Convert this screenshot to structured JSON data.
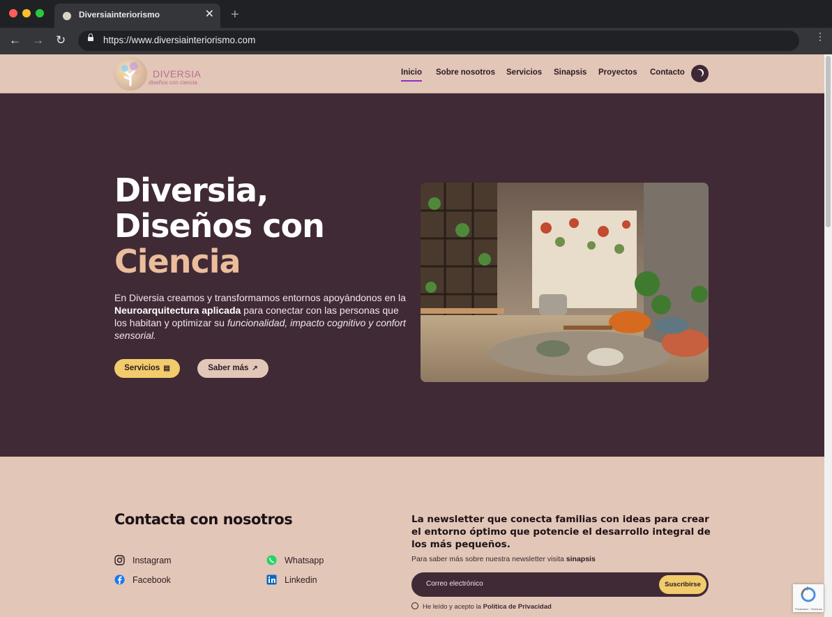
{
  "browser": {
    "tab_title": "Diversiainteriorismo",
    "url": "https://www.diversiainteriorismo.com",
    "tab_close": "✕",
    "new_tab": "+",
    "back": "←",
    "forward": "→",
    "reload": "↻",
    "menu": "⋮"
  },
  "header": {
    "logo_word": "DIVERSIA",
    "logo_sub": "diseños con ciencia",
    "nav": [
      "Inicio",
      "Sobre nosotros",
      "Servicios",
      "Sinapsis",
      "Proyectos",
      "Contacto"
    ],
    "active_nav": "Inicio"
  },
  "hero": {
    "title_line1": "Diversia,",
    "title_line2": "Diseños con",
    "title_line3": "Ciencia",
    "text_1": "En Diversia creamos y transformamos entornos apoyándonos en la ",
    "text_bold": "Neuroarquitectura aplicada",
    "text_2": " para conectar con las personas que los habitan y optimizar su ",
    "text_italic": "funcionalidad, impacto cognitivo y confort sensorial",
    "text_3": ".",
    "btn_services": "Servicios",
    "btn_more": "Saber más"
  },
  "contact": {
    "title": "Contacta con nosotros",
    "social": {
      "instagram": "Instagram",
      "whatsapp": "Whatsapp",
      "facebook": "Facebook",
      "linkedin": "Linkedin"
    }
  },
  "newsletter": {
    "title": "La newsletter que conecta familias con ideas para crear el entorno óptimo que potencie el desarrollo integral de los más pequeños.",
    "sub_text": "Para saber más sobre nuestra newsletter visita ",
    "sub_link": "sinapsis",
    "email_placeholder": "Correo electrónico",
    "subscribe": "Suscribirse",
    "privacy_text": "He leído y acepto la ",
    "privacy_link": "Política de Privacidad"
  },
  "recaptcha": {
    "footer": "Privacidad - Términos"
  },
  "colors": {
    "hero_bg": "#402a36",
    "page_bg": "#e2c6b7",
    "accent_yellow": "#f2cb6c",
    "accent_peach": "#ebbd9b",
    "active_underline": "#8b2fc9"
  }
}
